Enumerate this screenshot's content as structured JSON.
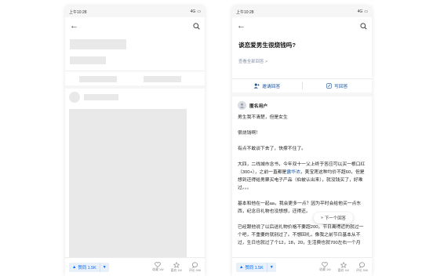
{
  "statusbar": {
    "time": "上午10:28",
    "network": "4G",
    "battery": "▮"
  },
  "left_phone": {
    "bottom": {
      "upvote_label": "赞同 1.5K",
      "favorites": "收藏 1W",
      "likes": "喜欢 1W",
      "comments": "评论 596"
    }
  },
  "right_phone": {
    "question_title": "谈恋爱男生很烧钱吗?",
    "view_all_answers": "查看全部回答 >",
    "invite_answer": "邀请回答",
    "write_answer": "写回答",
    "author_name": "匿名用户",
    "paragraphs": {
      "p1": "男生我不清楚，但是女生",
      "p2": "很烧钱啊！",
      "p3": "有点不敢谈下去了，快撑不住了。",
      "p4_before": "大四，二线城市念书，今年双十一父上终于答应可以买一根口红（300+），之前一直都是",
      "p4_highlight": "露华浓",
      "p4_after": "，美宝莲这种均价不超60，但是想到还得给男票买电子产品（伯被认出来），就没钱买了，好难过。。。",
      "p5": "基本和他在一起aa，我会更多一点？因为平时会给他买一点东西，纪念日礼物也没想想，还得还。",
      "p6": "已经跟他说了以后送礼物价格不要超200，节日离得近的就过一个吧，不重要的就别过了。不想回礼，像我之前节日基本从不过，生日也就过了个12，18，20，生活费也就700左右一个月"
    },
    "next_answer": "下一个回答",
    "bottom": {
      "upvote_label": "赞同 1.5K",
      "favorites": "收藏 1W",
      "likes": "喜欢 1W",
      "comments": "评论 596"
    }
  },
  "colors": {
    "accent": "#0066ff",
    "link": "#175199",
    "skeleton": "#e9e9e9"
  }
}
